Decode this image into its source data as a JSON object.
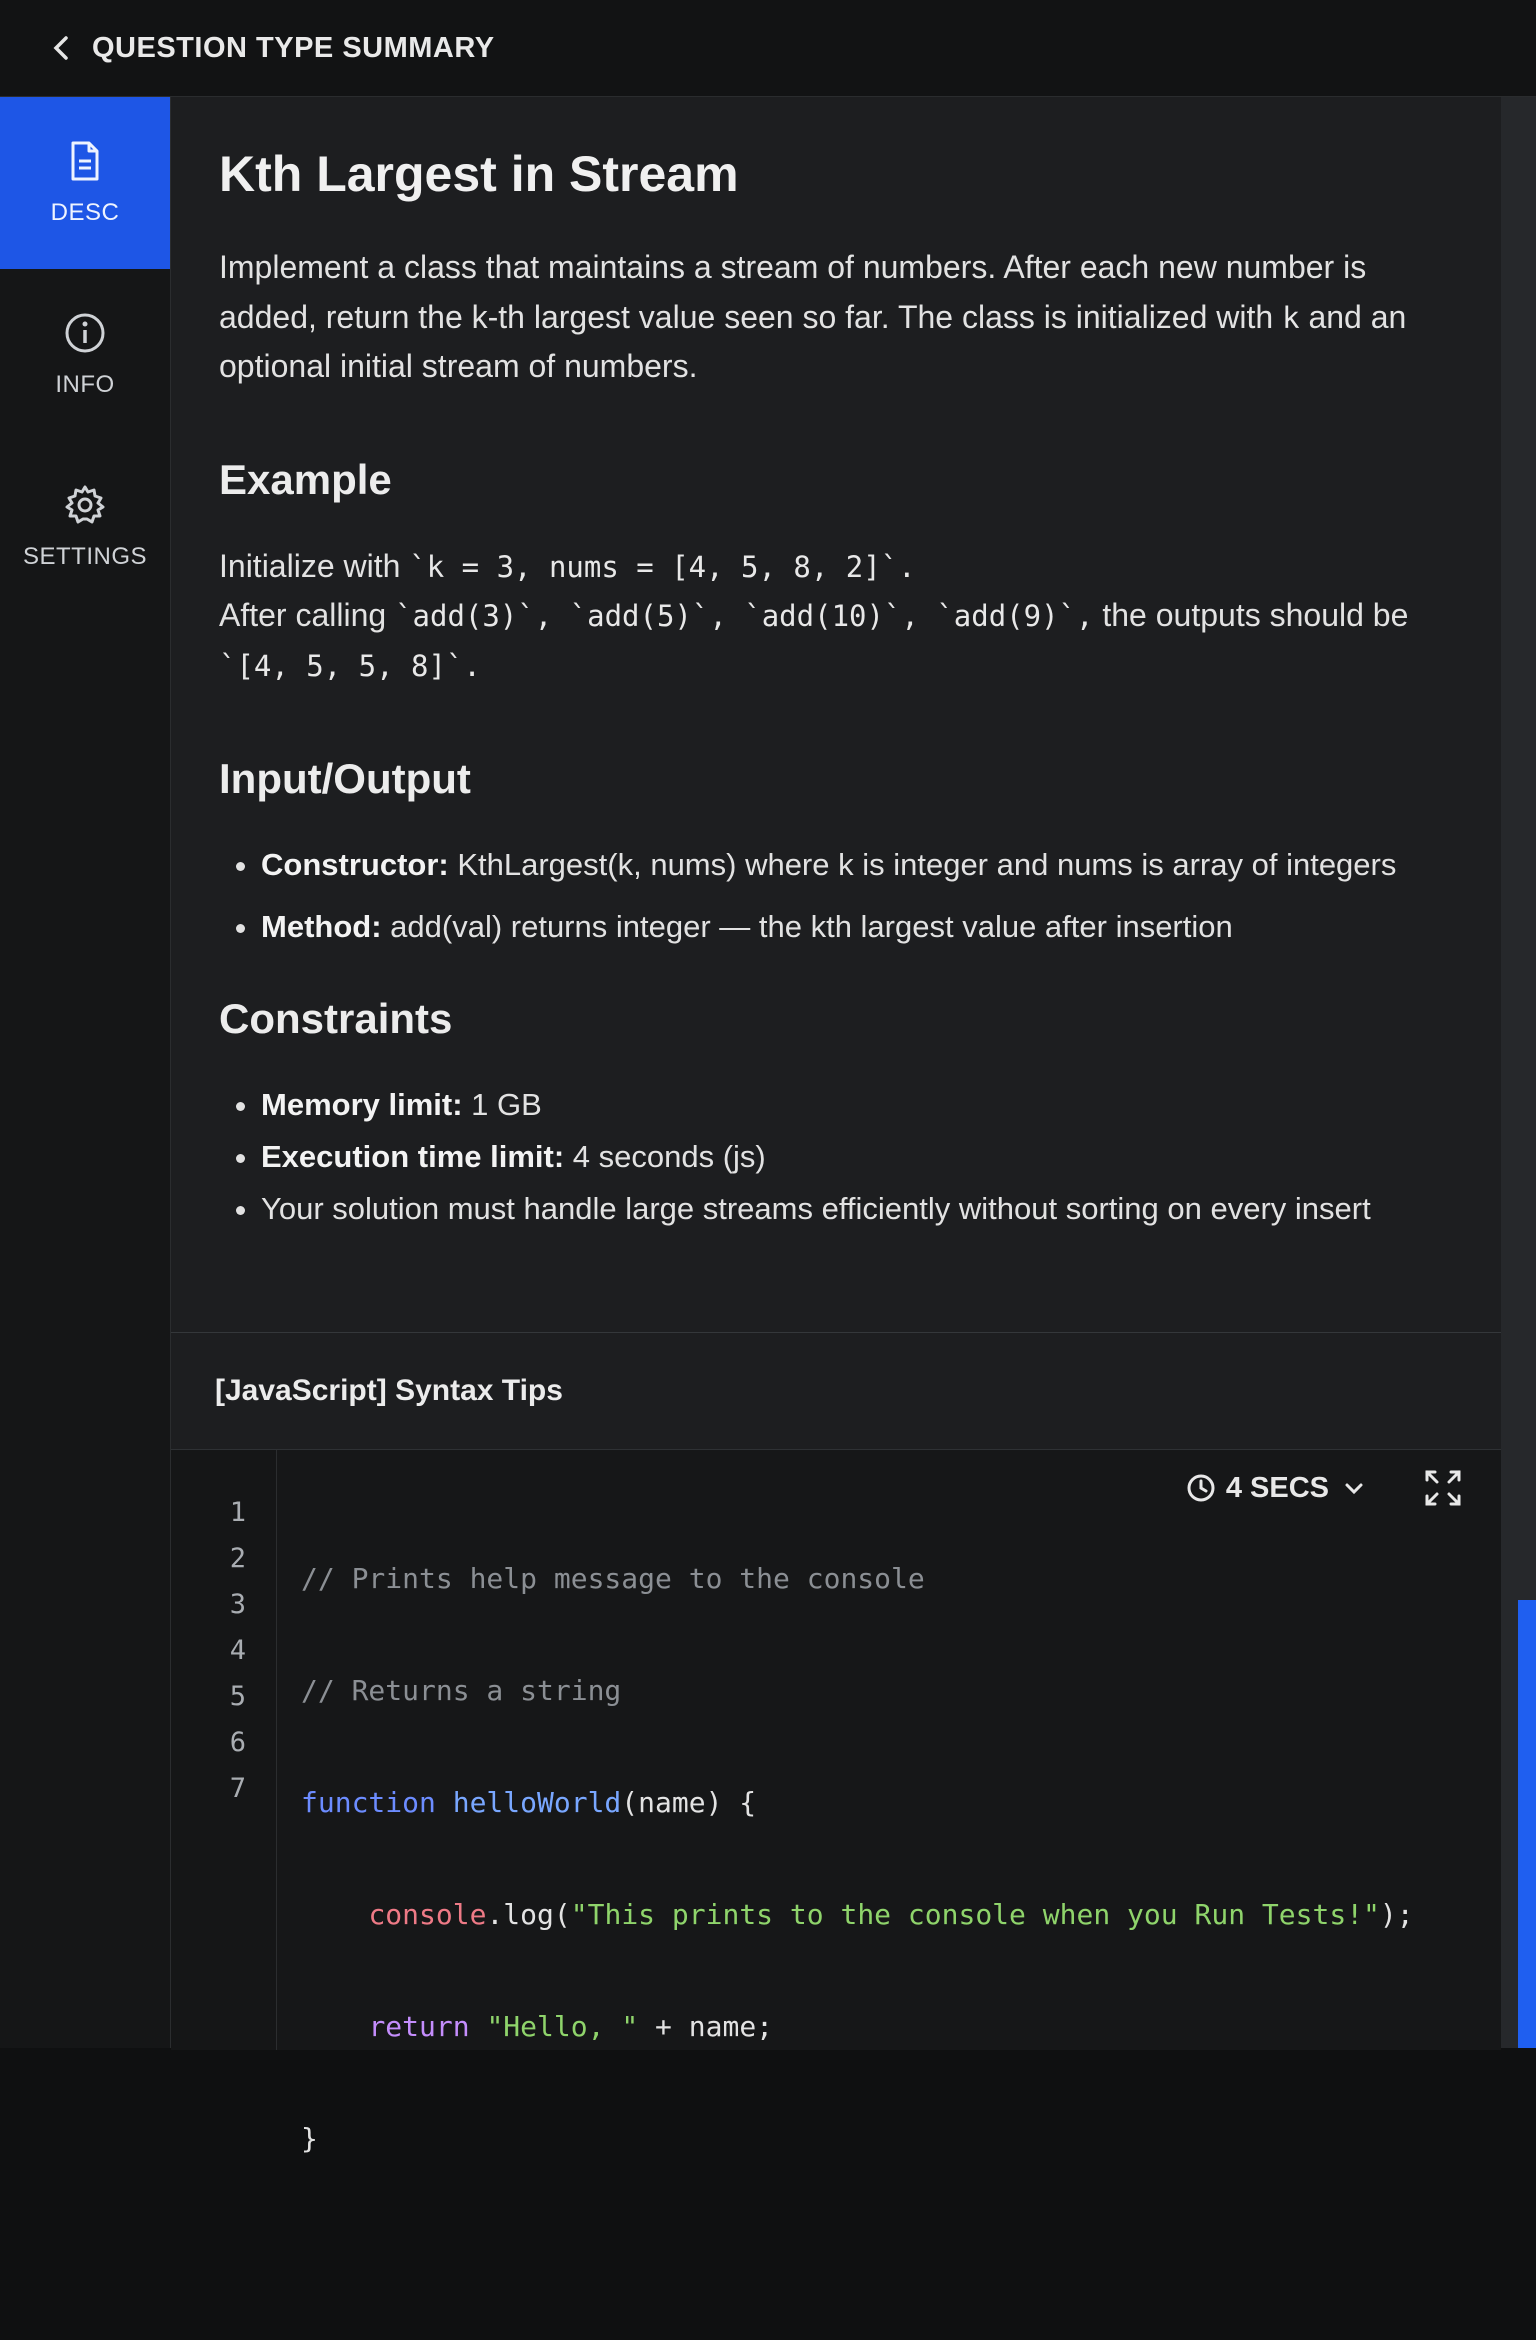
{
  "header": {
    "title": "QUESTION TYPE SUMMARY"
  },
  "sidebar": {
    "items": [
      {
        "label": "DESC",
        "icon": "document-icon",
        "active": true
      },
      {
        "label": "INFO",
        "icon": "info-icon",
        "active": false
      },
      {
        "label": "SETTINGS",
        "icon": "gear-icon",
        "active": false
      }
    ]
  },
  "problem": {
    "title": "Kth Largest in Stream",
    "description_1": "Implement a class that maintains a stream of numbers. After each new number is added, return the k-th largest value seen so far. The class is initialized with",
    "description_k": "k",
    "description_2": "and an optional initial stream of numbers.",
    "example_heading": "Example",
    "example_line_1_prefix": "Initialize with",
    "example_line_1_code": "`k = 3, nums = [4, 5, 8, 2]`.",
    "example_line_2_prefix": "After calling",
    "example_line_2_code": "`add(3)`, `add(5)`, `add(10)`, `add(9)`,",
    "example_line_2_suffix": "the outputs should be",
    "example_line_3_code": "`[4, 5, 5, 8]`.",
    "io_heading": "Input/Output",
    "io_items": [
      {
        "label": "Constructor:",
        "text": "KthLargest(k, nums) where k is integer and nums is array of integers"
      },
      {
        "label": "Method:",
        "text": "add(val) returns integer — the kth largest value after insertion"
      }
    ],
    "constraints_heading": "Constraints",
    "constraints": [
      {
        "label": "Memory limit:",
        "text": "1 GB"
      },
      {
        "label": "Execution time limit:",
        "text": "4 seconds (js)"
      },
      {
        "label": "",
        "text": "Your solution must handle large streams efficiently without sorting on every insert"
      }
    ]
  },
  "tips": {
    "header": "[JavaScript] Syntax Tips",
    "timer": "4 SECS",
    "line_numbers": [
      "1",
      "2",
      "3",
      "4",
      "5",
      "6",
      "7"
    ],
    "code": {
      "l1": "// Prints help message to the console",
      "l2": "// Returns a string",
      "l3_kw": "function",
      "l3_fn": "helloWorld",
      "l3_rest": "(name) {",
      "l4_obj": "console",
      "l4_mid": ".log(",
      "l4_str": "\"This prints to the console when you Run Tests!\"",
      "l4_end": ");",
      "l5_kw": "return",
      "l5_str": "\"Hello, \"",
      "l5_rest": " + name;",
      "l6": "}"
    }
  },
  "colors": {
    "accent": "#1e56e6",
    "background": "#1d1e20",
    "string": "#8fd46b",
    "keyword": "#6c8cff"
  }
}
